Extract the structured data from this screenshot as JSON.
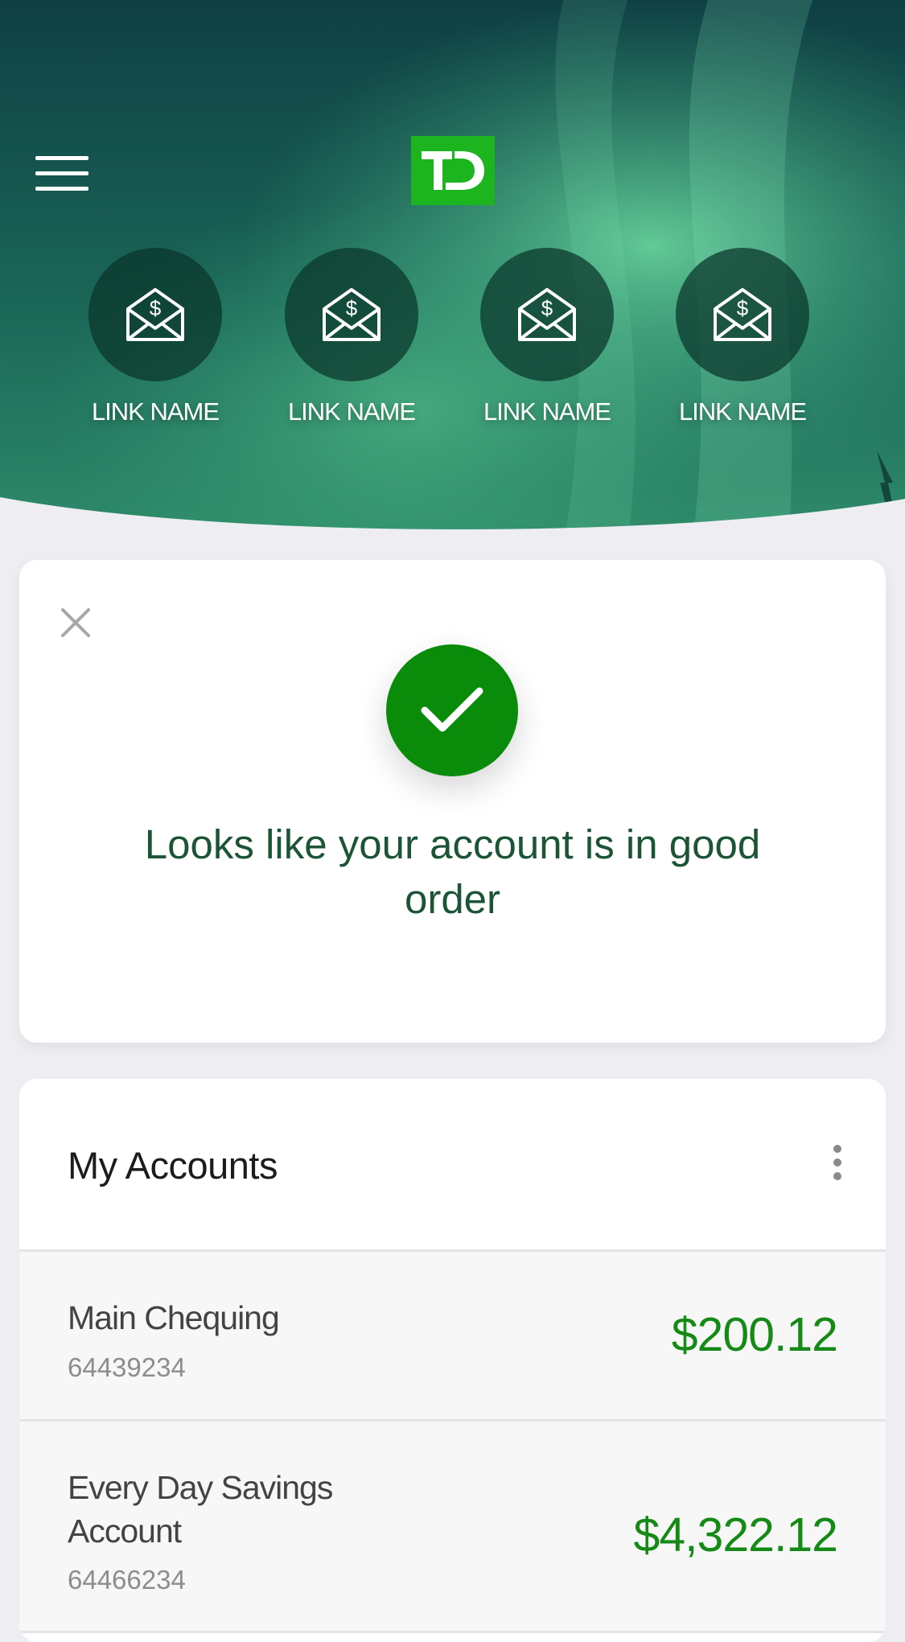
{
  "header": {
    "logo_text": "TD",
    "quick_links": [
      {
        "label": "LINK NAME",
        "icon": "envelope-dollar-icon"
      },
      {
        "label": "LINK NAME",
        "icon": "envelope-dollar-icon"
      },
      {
        "label": "LINK NAME",
        "icon": "envelope-dollar-icon"
      },
      {
        "label": "LINK NAME",
        "icon": "envelope-dollar-icon"
      }
    ]
  },
  "confirmation": {
    "message": "Looks like your account is in good order"
  },
  "accounts": {
    "title": "My Accounts",
    "items": [
      {
        "name": "Main Chequing",
        "number": "64439234",
        "balance": "$200.12"
      },
      {
        "name": "Every Day Savings Account",
        "number": "64466234",
        "balance": "$4,322.12"
      }
    ]
  },
  "colors": {
    "brand_green": "#1db51f",
    "success_green": "#0a8c0a",
    "balance_green": "#168a17",
    "message_green": "#1b5436"
  }
}
